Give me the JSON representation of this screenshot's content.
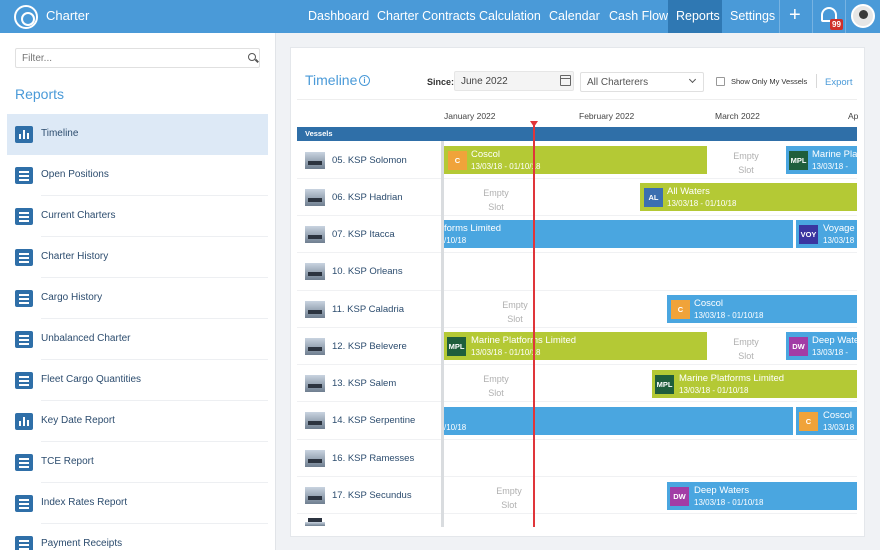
{
  "app": {
    "brand": "Charter"
  },
  "nav": {
    "items": [
      "Dashboard",
      "Charter Contracts",
      "Calculation",
      "Calendar",
      "Cash Flow",
      "Reports",
      "Settings"
    ],
    "active": "Reports",
    "notification_count": "99",
    "plus_icon": "plus-icon",
    "bell_icon": "bell-icon"
  },
  "sidebar": {
    "filter_placeholder": "Filter...",
    "title": "Reports",
    "items": [
      {
        "label": "Timeline",
        "icon": "bar-chart-icon"
      },
      {
        "label": "Open Positions",
        "icon": "list-icon"
      },
      {
        "label": "Current Charters",
        "icon": "list-icon"
      },
      {
        "label": "Charter History",
        "icon": "list-icon"
      },
      {
        "label": "Cargo History",
        "icon": "list-icon"
      },
      {
        "label": "Unbalanced Charter",
        "icon": "list-icon"
      },
      {
        "label": "Fleet Cargo Quantities",
        "icon": "list-icon"
      },
      {
        "label": "Key Date Report",
        "icon": "bar-chart-icon"
      },
      {
        "label": "TCE Report",
        "icon": "list-icon"
      },
      {
        "label": "Index Rates Report",
        "icon": "list-icon"
      },
      {
        "label": "Payment Receipts",
        "icon": "list-icon"
      }
    ],
    "active_index": 0
  },
  "timeline": {
    "title": "Timeline",
    "since_label": "Since:",
    "since_value": "June 2022",
    "charterers_value": "All Charterers",
    "show_only_mine": "Show Only My Vessels",
    "show_only_mine_checked": false,
    "export": "Export",
    "months": [
      "January 2022",
      "February 2022",
      "March 2022",
      "Ap"
    ],
    "vessels_header": "Vessels",
    "empty_line1": "Empty",
    "empty_line2": "Slot",
    "vessels": [
      "05. KSP Solomon",
      "06. KSP Hadrian",
      "07. KSP Itacca",
      "10. KSP Orleans",
      "11. KSP Caladria",
      "12. KSP Belevere",
      "13. KSP Salem",
      "14. KSP Serpentine",
      "16. KSP Ramesses",
      "17. KSP Secundus"
    ],
    "bars": [
      {
        "name": "Coscol",
        "dates": "13/03/18 - 01/10/18",
        "logo": "C",
        "color": "#b4c935",
        "logo_color": "#f0a33a"
      },
      {
        "name": "Marine Platf",
        "dates": "13/03/18 -",
        "logo": "MPL",
        "color": "#4aa6e0",
        "logo_color": "#1f5e3c"
      },
      {
        "name": "All Waters",
        "dates": "13/03/18 - 01/10/18",
        "logo": "AL",
        "color": "#b4c935",
        "logo_color": "#3c6fb0"
      },
      {
        "name": "forms Limited",
        "dates": "/10/18",
        "logo": "",
        "color": "#4aa6e0",
        "logo_color": ""
      },
      {
        "name": "Voyage",
        "dates": "13/03/18",
        "logo": "VOY",
        "color": "#4aa6e0",
        "logo_color": "#3a35a0"
      },
      {
        "name": "Coscol",
        "dates": "13/03/18 - 01/10/18",
        "logo": "C",
        "color": "#4aa6e0",
        "logo_color": "#f0a33a"
      },
      {
        "name": "Marine Platforms Limited",
        "dates": "13/03/18 - 01/10/18",
        "logo": "MPL",
        "color": "#b4c935",
        "logo_color": "#1f5e3c"
      },
      {
        "name": "Deep Wate",
        "dates": "13/03/18 -",
        "logo": "DW",
        "color": "#4aa6e0",
        "logo_color": "#a23ca6"
      },
      {
        "name": "Marine Platforms Limited",
        "dates": "13/03/18 - 01/10/18",
        "logo": "MPL",
        "color": "#b4c935",
        "logo_color": "#1f5e3c"
      },
      {
        "name": "",
        "dates": "/10/18",
        "logo": "",
        "color": "#4aa6e0",
        "logo_color": ""
      },
      {
        "name": "Coscol",
        "dates": "13/03/18",
        "logo": "C",
        "color": "#4aa6e0",
        "logo_color": "#f0a33a"
      },
      {
        "name": "Deep Waters",
        "dates": "13/03/18 - 01/10/18",
        "logo": "DW",
        "color": "#4aa6e0",
        "logo_color": "#a23ca6"
      }
    ]
  }
}
